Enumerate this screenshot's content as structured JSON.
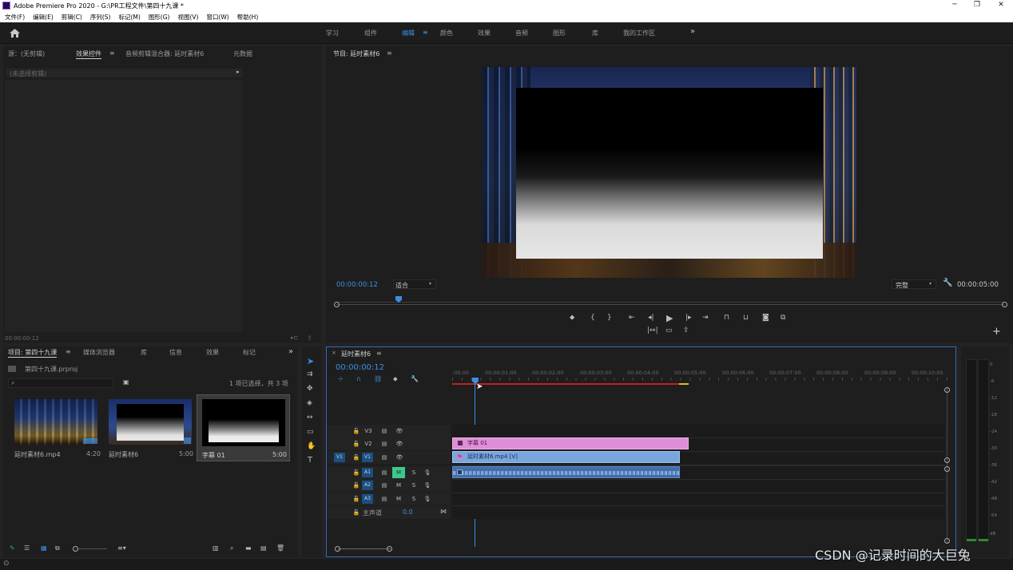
{
  "window": {
    "title": "Adobe Premiere Pro 2020 - G:\\PR工程文件\\第四十九课 *"
  },
  "menu": [
    "文件(F)",
    "编辑(E)",
    "剪辑(C)",
    "序列(S)",
    "标记(M)",
    "图形(G)",
    "视图(V)",
    "窗口(W)",
    "帮助(H)"
  ],
  "workspaces": [
    "学习",
    "组件",
    "编辑",
    "颜色",
    "效果",
    "音频",
    "图形",
    "库",
    "我的工作区"
  ],
  "active_workspace": "编辑",
  "source_panel": {
    "tabs": [
      "源：(无剪辑)",
      "效果控件",
      "音频剪辑混合器: 延时素材6",
      "元数据"
    ],
    "active_tab": "效果控件",
    "no_clip": "(未选择剪辑)",
    "timecode": "00:00:00:12"
  },
  "program_monitor": {
    "title": "节目: 延时素材6",
    "timecode": "00:00:00:12",
    "zoom": "适合",
    "quality": "完整",
    "duration": "00:00:05:00"
  },
  "project_panel": {
    "tabs": [
      "项目: 第四十九课",
      "媒体浏览器",
      "库",
      "信息",
      "效果",
      "标记"
    ],
    "file": "第四十九课.prproj",
    "selection_info": "1 项已选择，共 3 项",
    "items": [
      {
        "name": "延时素材6.mp4",
        "duration": "4:20"
      },
      {
        "name": "延时素材6",
        "duration": "5:00"
      },
      {
        "name": "字幕 01",
        "duration": "5:00"
      }
    ]
  },
  "timeline": {
    "title": "延时素材6",
    "timecode": "00:00:00:12",
    "ruler": [
      ":00:00",
      "00:00:01:00",
      "00:00:02:00",
      "00:00:03:00",
      "00:00:04:00",
      "00:00:05:00",
      "00:00:06:00",
      "00:00:07:00",
      "00:00:08:00",
      "00:00:09:00",
      "00:00:10:00"
    ],
    "video_tracks": [
      "V3",
      "V2",
      "V1"
    ],
    "audio_tracks": [
      "A1",
      "A2",
      "A3"
    ],
    "source_v": "V1",
    "master": {
      "label": "主声道",
      "value": "0.0"
    },
    "clips": {
      "title": "字幕 01",
      "video": "延时素材6.mp4 [V]"
    }
  },
  "meter_ticks": [
    "0",
    "-6",
    "-12",
    "-18",
    "-24",
    "-30",
    "-36",
    "-42",
    "-48",
    "-54",
    "dB"
  ],
  "watermark": "CSDN @记录时间的大巨兔",
  "colors": {
    "accent": "#3c8fe5",
    "title_clip": "#e08ed8",
    "video_clip": "#7aa6df",
    "audio_clip": "#3f6fb0",
    "playhead": "#3c8fe5"
  }
}
